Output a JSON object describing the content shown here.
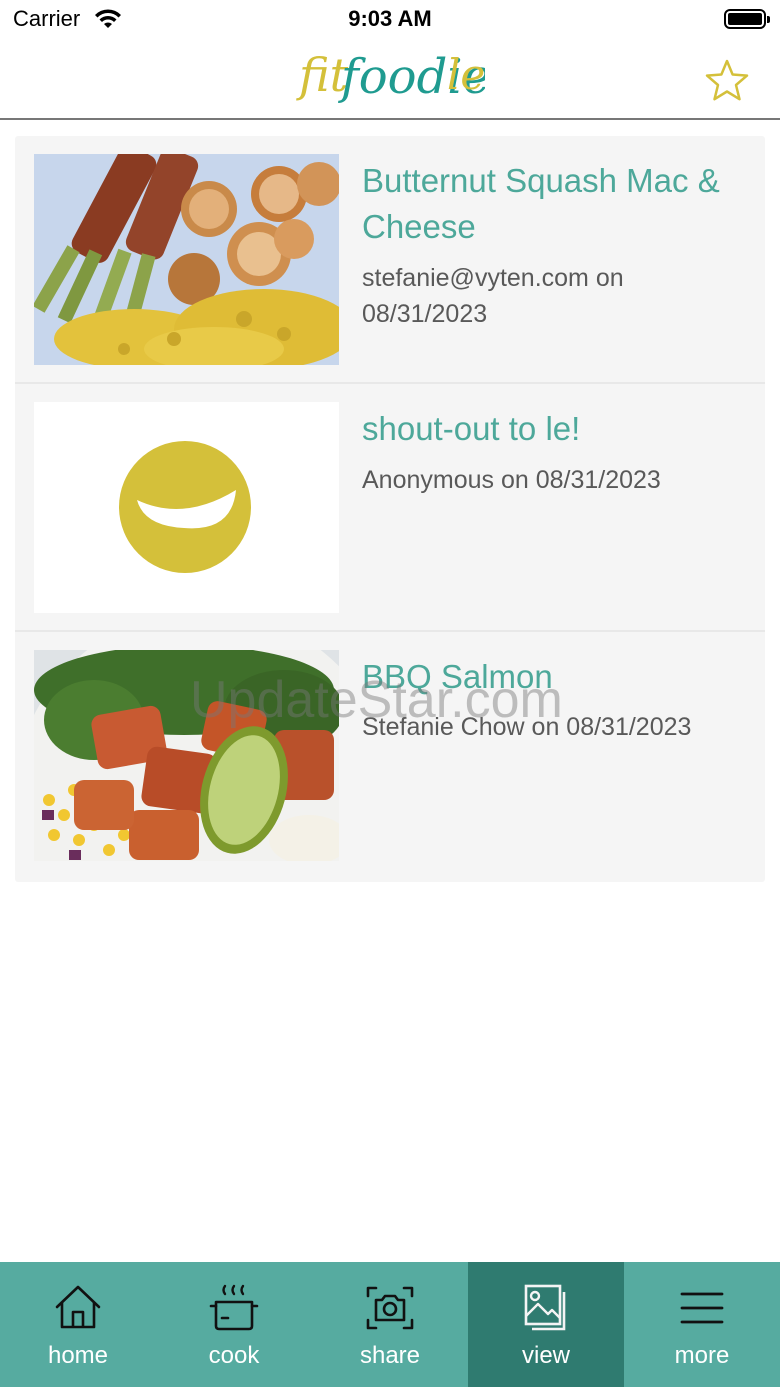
{
  "status_bar": {
    "carrier": "Carrier",
    "time": "9:03 AM"
  },
  "header": {
    "logo_text": "fitfoodiele",
    "favorite_icon": "star-outline-icon"
  },
  "posts": [
    {
      "title": "Butternut Squash Mac & Cheese",
      "meta": "stefanie@vyten.com on 08/31/2023",
      "image": "scallops-asparagus-mac-photo"
    },
    {
      "title": "shout-out to le!",
      "meta": "Anonymous on 08/31/2023",
      "image": "yellow-smile-logo"
    },
    {
      "title": "BBQ Salmon",
      "meta": "Stefanie Chow on 08/31/2023",
      "image": "salmon-avocado-bowl-photo"
    }
  ],
  "watermark": "UpdateStar.com",
  "tabs": [
    {
      "label": "home",
      "icon": "home-icon",
      "active": false
    },
    {
      "label": "cook",
      "icon": "pot-icon",
      "active": false
    },
    {
      "label": "share",
      "icon": "camera-icon",
      "active": false
    },
    {
      "label": "view",
      "icon": "gallery-icon",
      "active": true
    },
    {
      "label": "more",
      "icon": "menu-icon",
      "active": false
    }
  ],
  "colors": {
    "accent": "#4da89a",
    "tabbar": "#56aba0",
    "tab_active": "#2f7b70",
    "brand_yellow": "#d4c03a"
  }
}
